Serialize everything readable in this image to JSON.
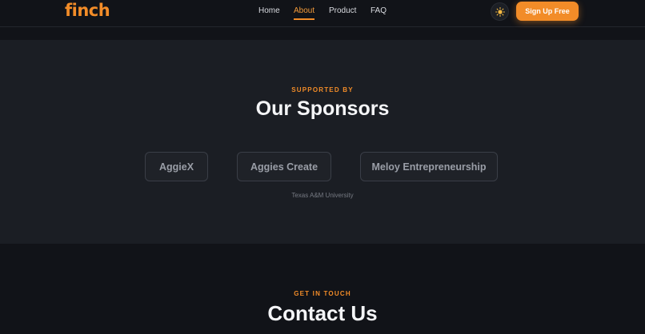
{
  "brand": {
    "logo_text": "finch",
    "accent_color": "#f28c28"
  },
  "nav": {
    "links": [
      {
        "label": "Home",
        "active": false
      },
      {
        "label": "About",
        "active": true
      },
      {
        "label": "Product",
        "active": false
      },
      {
        "label": "FAQ",
        "active": false
      }
    ],
    "theme_toggle_icon": "sun-icon",
    "signup_label": "Sign Up Free"
  },
  "sponsors": {
    "eyebrow": "SUPPORTED BY",
    "title": "Our Sponsors",
    "items": [
      {
        "name": "AggieX"
      },
      {
        "name": "Aggies Create"
      },
      {
        "name": "Meloy Entrepreneurship"
      }
    ],
    "footnote": "Texas A&M University"
  },
  "contact": {
    "eyebrow": "GET IN TOUCH",
    "title": "Contact Us"
  }
}
